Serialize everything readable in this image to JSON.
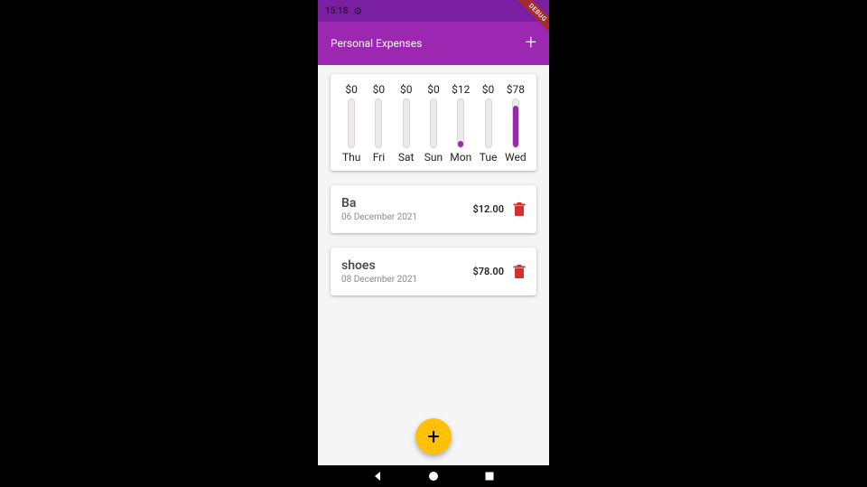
{
  "status": {
    "time": "15:18",
    "debug_label": "DEBUG"
  },
  "appbar": {
    "title": "Personal Expenses"
  },
  "chart_data": {
    "type": "bar",
    "categories": [
      "Thu",
      "Fri",
      "Sat",
      "Sun",
      "Mon",
      "Tue",
      "Wed"
    ],
    "values": [
      0,
      0,
      0,
      0,
      12,
      0,
      78
    ],
    "amount_labels": [
      "$0",
      "$0",
      "$0",
      "$0",
      "$12",
      "$0",
      "$78"
    ],
    "fill_pct": [
      0,
      0,
      0,
      0,
      13,
      0,
      87
    ],
    "title": "",
    "xlabel": "",
    "ylabel": ""
  },
  "transactions": [
    {
      "title": "Ba",
      "date": "06 December 2021",
      "amount": "$12.00"
    },
    {
      "title": "shoes",
      "date": "08 December 2021",
      "amount": "$78.00"
    }
  ],
  "colors": {
    "primary": "#9C27B0",
    "primary_dark": "#7B1FA2",
    "fab": "#FFC107",
    "danger": "#d32f2f"
  }
}
